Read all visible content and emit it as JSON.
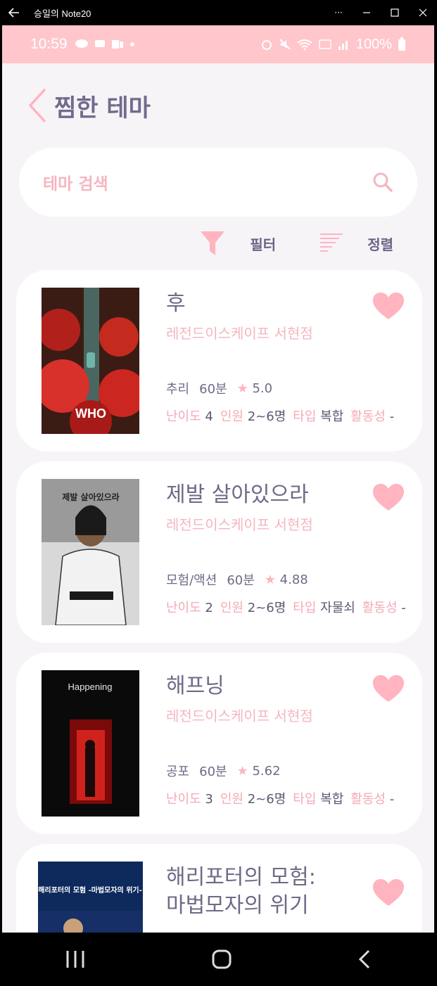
{
  "window": {
    "title": "승일의 Note20",
    "more": "···"
  },
  "status_bar": {
    "time": "10:59",
    "battery": "100%"
  },
  "header": {
    "title": "찜한 테마"
  },
  "search": {
    "placeholder": "테마 검색"
  },
  "toolbar": {
    "filter_label": "필터",
    "sort_label": "정렬"
  },
  "labels": {
    "difficulty": "난이도",
    "players": "인원",
    "type": "타입",
    "activity": "활동성"
  },
  "themes": [
    {
      "name": "후",
      "store": "레전드이스케이프 서현점",
      "genre": "추리",
      "duration": "60분",
      "rating": "5.0",
      "difficulty": "4",
      "players": "2~6명",
      "type": "복합",
      "activity": "-",
      "poster_text": "WHO"
    },
    {
      "name": "제발 살아있으라",
      "store": "레전드이스케이프 서현점",
      "genre": "모험/액션",
      "duration": "60분",
      "rating": "4.88",
      "difficulty": "2",
      "players": "2~6명",
      "type": "자물쇠",
      "activity": "-",
      "poster_text": "제발 살아있으라"
    },
    {
      "name": "해프닝",
      "store": "레전드이스케이프 서현점",
      "genre": "공포",
      "duration": "60분",
      "rating": "5.62",
      "difficulty": "3",
      "players": "2~6명",
      "type": "복합",
      "activity": "-",
      "poster_text": "Happening"
    },
    {
      "name": "해리포터의 모험:\n마법모자의 위기",
      "store": "",
      "poster_text": "해리포터의 모험 -마법모자의 위기-"
    }
  ],
  "colors": {
    "accent_pink": "#ffb4bf",
    "text_purple": "#6f6a87",
    "status_bar": "#ffc6cc",
    "background": "#f7f4f8"
  }
}
